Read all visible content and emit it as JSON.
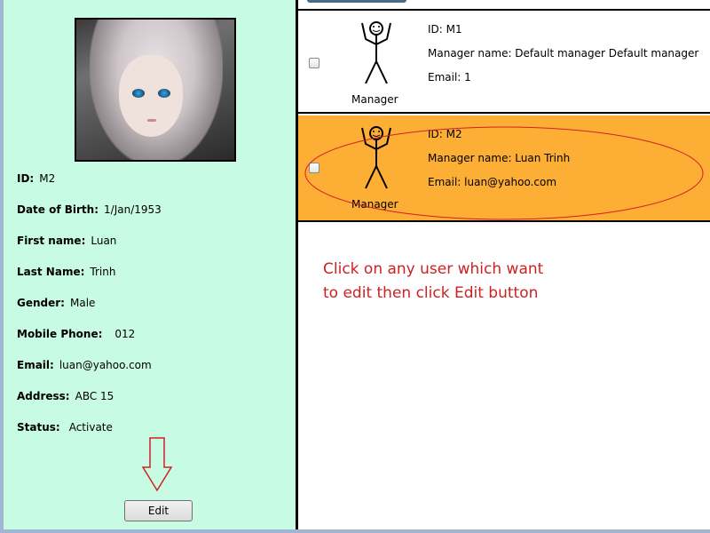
{
  "details": {
    "id_label": "ID:",
    "id_value": "M2",
    "dob_label": "Date of Birth:",
    "dob_value": "1/Jan/1953",
    "first_label": "First name:",
    "first_value": "Luan",
    "last_label": "Last Name:",
    "last_value": "Trinh",
    "gender_label": "Gender:",
    "gender_value": "Male",
    "mobile_label": "Mobile Phone:",
    "mobile_value": "012",
    "email_label": "Email:",
    "email_value": "luan@yahoo.com",
    "address_label": "Address:",
    "address_value": "ABC 15",
    "status_label": "Status:",
    "status_value": "Activate"
  },
  "edit_button": {
    "label": "Edit"
  },
  "users": [
    {
      "role": "Manager",
      "id": "ID: M1",
      "name": "Manager name: Default manager Default manager",
      "email": "Email: 1",
      "selected": false
    },
    {
      "role": "Manager",
      "id": "ID: M2",
      "name": "Manager name: Luan Trinh",
      "email": "Email: luan@yahoo.com",
      "selected": true
    }
  ],
  "instruction": {
    "line1": "Click on any user which want",
    "line2": "to edit then click Edit button"
  },
  "colors": {
    "left_panel_bg": "#c8fbe3",
    "selected_row_bg": "#fdae35",
    "annotation_red": "#cc2222"
  }
}
